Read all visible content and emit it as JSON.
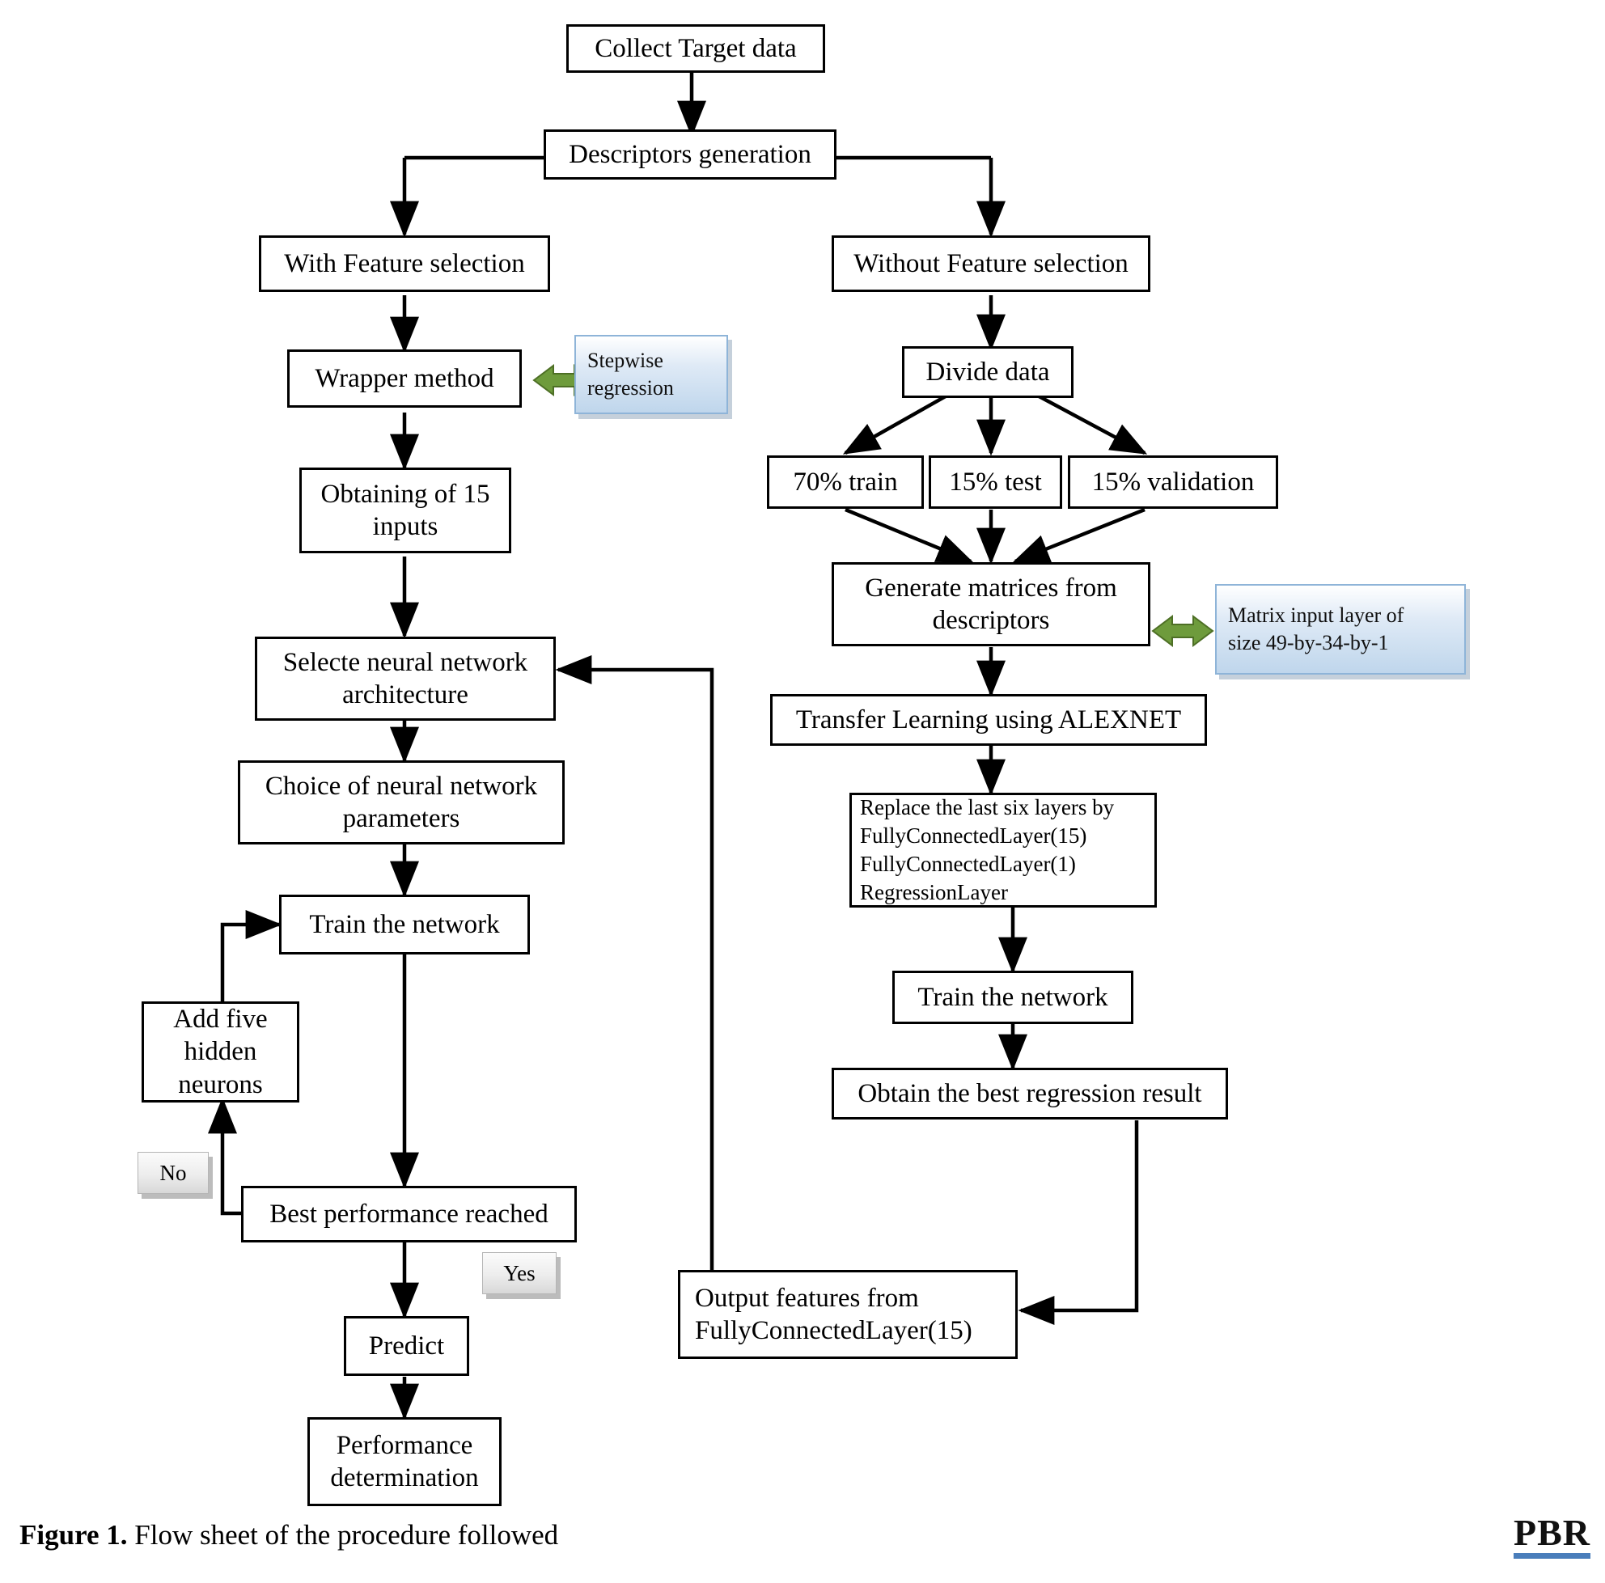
{
  "figure": {
    "label": "Figure 1.",
    "caption": " Flow sheet of the procedure followed",
    "logo": "PBR",
    "logo_bar_color": "#4a7ebb"
  },
  "colors": {
    "box_border": "#000000",
    "box_fill": "#ffffff",
    "callout_border": "#8eb4d8",
    "callout_fill_top": "#ffffff",
    "callout_fill_bottom": "#bfd6ec",
    "connector_arrow": "#6e9b3c",
    "tag_fill": "#ededed",
    "line": "#000000"
  },
  "flow": {
    "nodes": {
      "collect_target_data": "Collect Target data",
      "descriptors_generation": "Descriptors generation",
      "with_feature_selection": "With Feature selection",
      "without_feature_selection": "Without Feature selection",
      "wrapper_method": "Wrapper method",
      "divide_data": "Divide data",
      "obtaining_inputs": "Obtaining of 15 inputs",
      "train_split": "70% train",
      "test_split": "15% test",
      "validation_split": "15% validation",
      "generate_matrices": "Generate matrices from descriptors",
      "select_architecture": "Selecte neural network architecture",
      "transfer_learning": "Transfer Learning using ALEXNET",
      "choice_parameters": "Choice of neural network parameters",
      "replace_layers_line1": "Replace the last six layers by",
      "replace_layers_line2": "FullyConnectedLayer(15)",
      "replace_layers_line3": "FullyConnectedLayer(1)",
      "replace_layers_line4": "RegressionLayer",
      "train_network_left": "Train the network",
      "train_network_right": "Train the network",
      "add_hidden_neurons": "Add five hidden neurons",
      "best_regression_result": "Obtain the best regression result",
      "best_performance": "Best performance reached",
      "output_features_line1": "Output features from",
      "output_features_line2": "FullyConnectedLayer(15)",
      "predict": "Predict",
      "performance_determination": "Performance determination"
    },
    "callouts": {
      "stepwise_regression_line1": "Stepwise",
      "stepwise_regression_line2": "regression",
      "matrix_input_line1": "Matrix input layer of",
      "matrix_input_line2": "size 49-by-34-by-1"
    },
    "decision_labels": {
      "no": "No",
      "yes": "Yes"
    }
  },
  "chart_data": {
    "type": "diagram",
    "title": "Flow sheet of the procedure followed",
    "subtype": "flowchart",
    "branches": [
      {
        "name": "With Feature selection",
        "steps": [
          "With Feature selection",
          "Wrapper method",
          "Obtaining of 15 inputs",
          "Selecte neural network architecture",
          "Choice of neural network parameters",
          "Train the network",
          "Best performance reached",
          "Predict",
          "Performance determination"
        ],
        "loop": "Best performance reached -> No -> Add five hidden neurons -> Train the network",
        "exit": "Best performance reached -> Yes -> Predict",
        "side_callout": "Stepwise regression (linked to Wrapper method)"
      },
      {
        "name": "Without Feature selection",
        "steps": [
          "Without Feature selection",
          "Divide data",
          "70% train / 15% test / 15% validation",
          "Generate matrices from descriptors",
          "Transfer Learning using ALEXNET",
          "Replace the last six layers by FullyConnectedLayer(15) FullyConnectedLayer(1) RegressionLayer",
          "Train the network",
          "Obtain the best regression result",
          "Output features from FullyConnectedLayer(15)"
        ],
        "side_callout": "Matrix input layer of size 49-by-34-by-1 (linked to Generate matrices from descriptors)",
        "feedback": "Output features from FullyConnectedLayer(15) -> Selecte neural network architecture"
      }
    ],
    "root": "Collect Target data -> Descriptors generation"
  }
}
